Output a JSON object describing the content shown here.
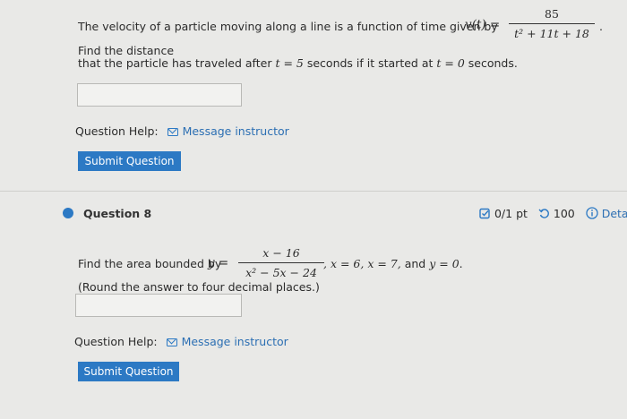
{
  "q7": {
    "intro": "The velocity of a particle moving along a line is a function of time given by",
    "fn_lhs": "v(t) =",
    "frac_num": "85",
    "frac_den": "t² + 11t + 18",
    "trail": ".",
    "find": "Find the distance",
    "line2_a": "that the particle has traveled after",
    "t_eq5": "t = 5",
    "line2_b": "seconds if it started at",
    "t_eq0": "t = 0",
    "line2_c": "seconds.",
    "help_label": "Question Help:",
    "message_label": "Message instructor",
    "submit_label": "Submit Question"
  },
  "q8": {
    "title": "Question 8",
    "score": "0/1 pt",
    "attempts": "100",
    "details": "Details",
    "find_prefix": "Find the area bounded by",
    "y_eq": "y =",
    "frac_num": "x − 16",
    "frac_den": "x² − 5x − 24",
    "conditions": ", x = 6, x = 7,",
    "and": "and",
    "y_zero": "y = 0",
    "period": ".",
    "round_note": "(Round the answer to four decimal places.)",
    "help_label": "Question Help:",
    "message_label": "Message instructor",
    "submit_label": "Submit Question"
  },
  "colors": {
    "accent": "#2c79c4",
    "page_bg": "#e9e9e7"
  }
}
